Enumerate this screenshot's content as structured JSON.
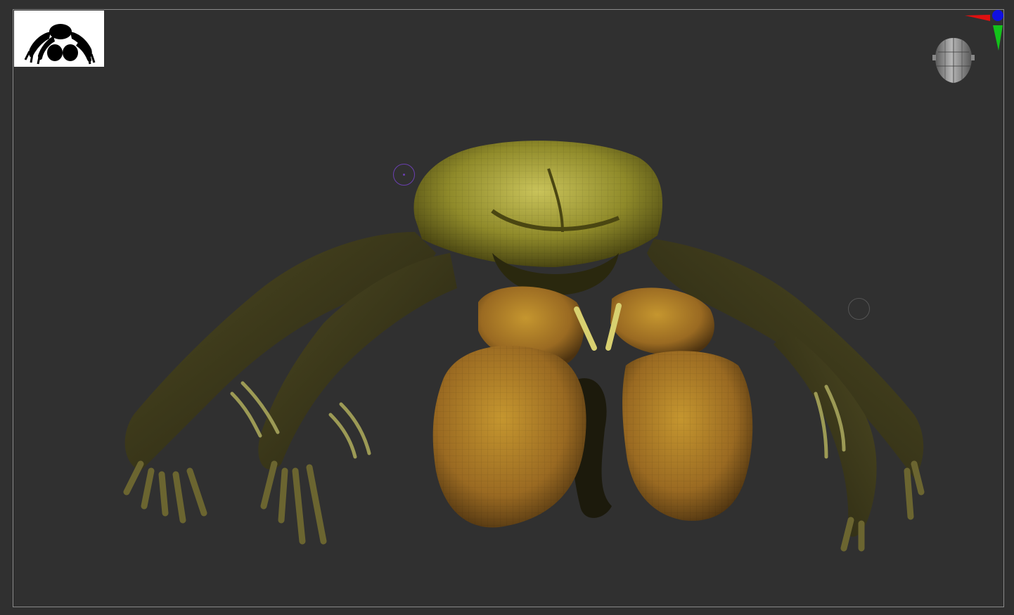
{
  "viewport": {
    "background_color": "#303030",
    "frame_color": "#8a8a8a"
  },
  "thumbnail": {
    "background_color": "#ffffff",
    "silhouette_color": "#000000",
    "icon": "model-silhouette-thumbnail"
  },
  "model": {
    "icon": "crab-creature-sculpt",
    "colors": {
      "shell": "#8f8a2a",
      "shell_highlight": "#c9c35a",
      "claw": "#9a6a22",
      "claw_highlight": "#c5962f",
      "legs": "#3e3a1a",
      "legs_highlight": "#6b6530",
      "dark": "#1c1a0c"
    }
  },
  "navigation": {
    "head_gizmo_icon": "head-navigation-icon",
    "axis_gizmo_icon": "axis-orientation-icon",
    "axis_colors": {
      "x": "#e01010",
      "y": "#12c21a",
      "z": "#1010e0"
    }
  },
  "cursor": {
    "brush_color": "#6a3fb0",
    "secondary_color": "#555555"
  }
}
